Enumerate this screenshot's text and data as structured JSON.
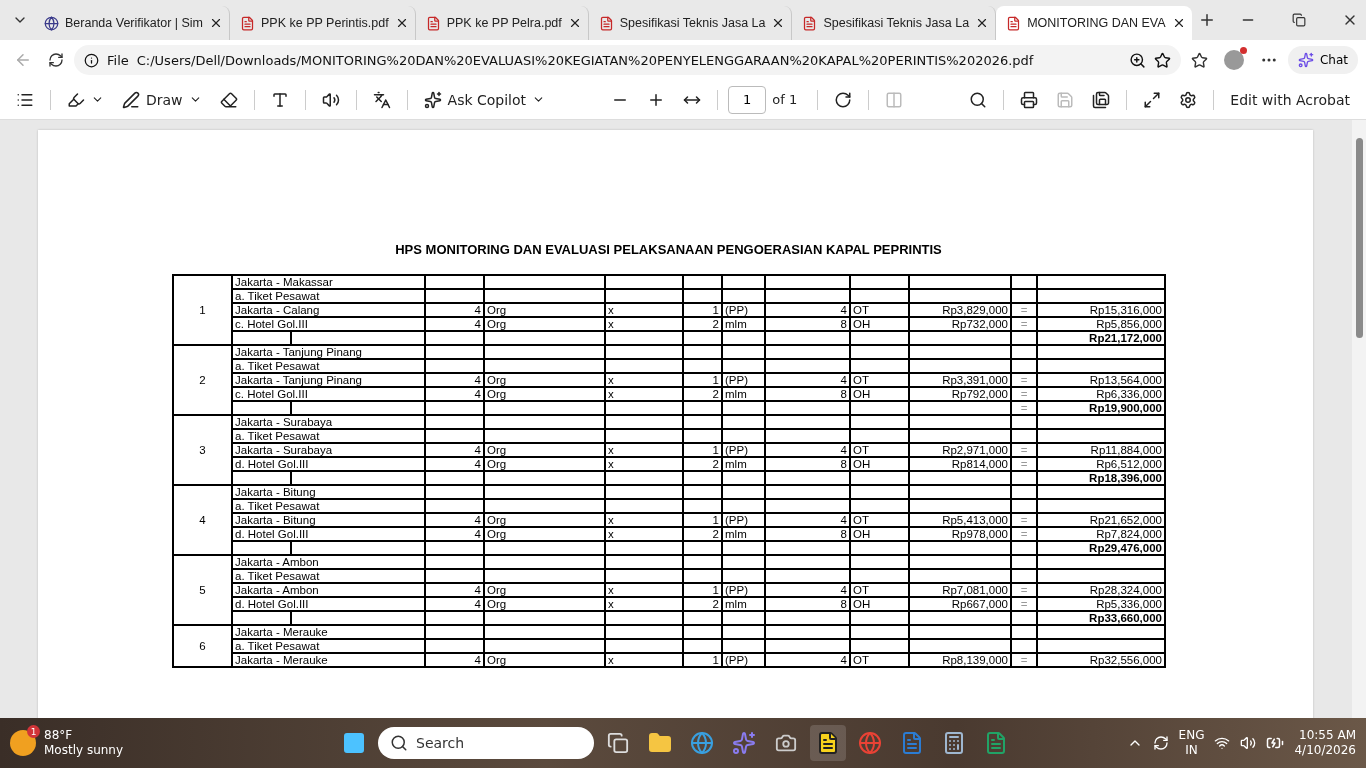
{
  "tabs": [
    {
      "title": "Beranda Verifikator | Sim",
      "kind": "site",
      "selected": false
    },
    {
      "title": "PPK ke PP Perintis.pdf",
      "kind": "pdf",
      "selected": false
    },
    {
      "title": "PPK ke PP Pelra.pdf",
      "kind": "pdf",
      "selected": false
    },
    {
      "title": "Spesifikasi Teknis Jasa La",
      "kind": "pdf",
      "selected": false
    },
    {
      "title": "Spesifikasi Teknis Jasa La",
      "kind": "pdf",
      "selected": false
    },
    {
      "title": "MONITORING DAN EVA",
      "kind": "pdf",
      "selected": true
    }
  ],
  "address_bar": {
    "scheme": "File",
    "url": "C:/Users/Dell/Downloads/MONITORING%20DAN%20EVALUASI%20KEGIATAN%20PENYELENGGARAAN%20KAPAL%20PERINTIS%202026.pdf",
    "chat": "Chat"
  },
  "pdf_toolbar": {
    "draw": "Draw",
    "copilot": "Ask Copilot",
    "page": "1",
    "page_count": "of 1",
    "edit": "Edit with Acrobat"
  },
  "document": {
    "title": "HPS MONITORING DAN EVALUASI PELAKSANAAN PENGOERASIAN KAPAL PEPRINTIS",
    "groups": [
      {
        "no": "1",
        "route": "Jakarta - Makassar",
        "sub": "a. Tiket Pesawat",
        "items": [
          {
            "desc": "Jakarta - Calang",
            "qty": "4",
            "unit": "Org",
            "op": "x",
            "trips": "1",
            "trip_unit": "(PP)",
            "count": "4",
            "count_unit": "OT",
            "price": "Rp3,829,000",
            "eq": "=",
            "total": "Rp15,316,000"
          },
          {
            "desc": "c. Hotel Gol.III",
            "qty": "4",
            "unit": "Org",
            "op": "x",
            "trips": "2",
            "trip_unit": "mlm",
            "count": "8",
            "count_unit": "OH",
            "price": "Rp732,000",
            "eq": "=",
            "total": "Rp5,856,000"
          }
        ],
        "subtotal": "Rp21,172,000"
      },
      {
        "no": "2",
        "route": "Jakarta - Tanjung Pinang",
        "sub": "a. Tiket Pesawat",
        "items": [
          {
            "desc": "Jakarta - Tanjung Pinang",
            "qty": "4",
            "unit": "Org",
            "op": "x",
            "trips": "1",
            "trip_unit": "(PP)",
            "count": "4",
            "count_unit": "OT",
            "price": "Rp3,391,000",
            "eq": "=",
            "total": "Rp13,564,000"
          },
          {
            "desc": "c. Hotel Gol.III",
            "qty": "4",
            "unit": "Org",
            "op": "x",
            "trips": "2",
            "trip_unit": "mlm",
            "count": "8",
            "count_unit": "OH",
            "price": "Rp792,000",
            "eq": "=",
            "total": "Rp6,336,000"
          }
        ],
        "subtotal_eq": "=",
        "subtotal": "Rp19,900,000"
      },
      {
        "no": "3",
        "route": "Jakarta - Surabaya",
        "sub": "a. Tiket Pesawat",
        "items": [
          {
            "desc": "Jakarta - Surabaya",
            "qty": "4",
            "unit": "Org",
            "op": "x",
            "trips": "1",
            "trip_unit": "(PP)",
            "count": "4",
            "count_unit": "OT",
            "price": "Rp2,971,000",
            "eq": "=",
            "total": "Rp11,884,000"
          },
          {
            "desc": "d. Hotel Gol.III",
            "qty": "4",
            "unit": "Org",
            "op": "x",
            "trips": "2",
            "trip_unit": "mlm",
            "count": "8",
            "count_unit": "OH",
            "price": "Rp814,000",
            "eq": "=",
            "total": "Rp6,512,000"
          }
        ],
        "subtotal": "Rp18,396,000"
      },
      {
        "no": "4",
        "route": "Jakarta - Bitung",
        "sub": "a. Tiket Pesawat",
        "items": [
          {
            "desc": "Jakarta - Bitung",
            "qty": "4",
            "unit": "Org",
            "op": "x",
            "trips": "1",
            "trip_unit": "(PP)",
            "count": "4",
            "count_unit": "OT",
            "price": "Rp5,413,000",
            "eq": "=",
            "total": "Rp21,652,000"
          },
          {
            "desc": "d. Hotel Gol.III",
            "qty": "4",
            "unit": "Org",
            "op": "x",
            "trips": "2",
            "trip_unit": "mlm",
            "count": "8",
            "count_unit": "OH",
            "price": "Rp978,000",
            "eq": "=",
            "total": "Rp7,824,000"
          }
        ],
        "subtotal": "Rp29,476,000"
      },
      {
        "no": "5",
        "route": "Jakarta - Ambon",
        "sub": "a. Tiket Pesawat",
        "items": [
          {
            "desc": "Jakarta - Ambon",
            "qty": "4",
            "unit": "Org",
            "op": "x",
            "trips": "1",
            "trip_unit": "(PP)",
            "count": "4",
            "count_unit": "OT",
            "price": "Rp7,081,000",
            "eq": "=",
            "total": "Rp28,324,000"
          },
          {
            "desc": "d. Hotel Gol.III",
            "qty": "4",
            "unit": "Org",
            "op": "x",
            "trips": "2",
            "trip_unit": "mlm",
            "count": "8",
            "count_unit": "OH",
            "price": "Rp667,000",
            "eq": "=",
            "total": "Rp5,336,000"
          }
        ],
        "subtotal": "Rp33,660,000"
      },
      {
        "no": "6",
        "route": "Jakarta - Merauke",
        "sub": "a. Tiket Pesawat",
        "items": [
          {
            "desc": "Jakarta - Merauke",
            "qty": "4",
            "unit": "Org",
            "op": "x",
            "trips": "1",
            "trip_unit": "(PP)",
            "count": "4",
            "count_unit": "OT",
            "price": "Rp8,139,000",
            "eq": "=",
            "total": "Rp32,556,000"
          }
        ]
      }
    ]
  },
  "taskbar": {
    "weather_badge": "1",
    "temperature": "88°F",
    "weather": "Mostly sunny",
    "search": "Search",
    "lang": "ENG",
    "region": "IN",
    "time": "10:55 AM",
    "date": "4/10/2026"
  }
}
